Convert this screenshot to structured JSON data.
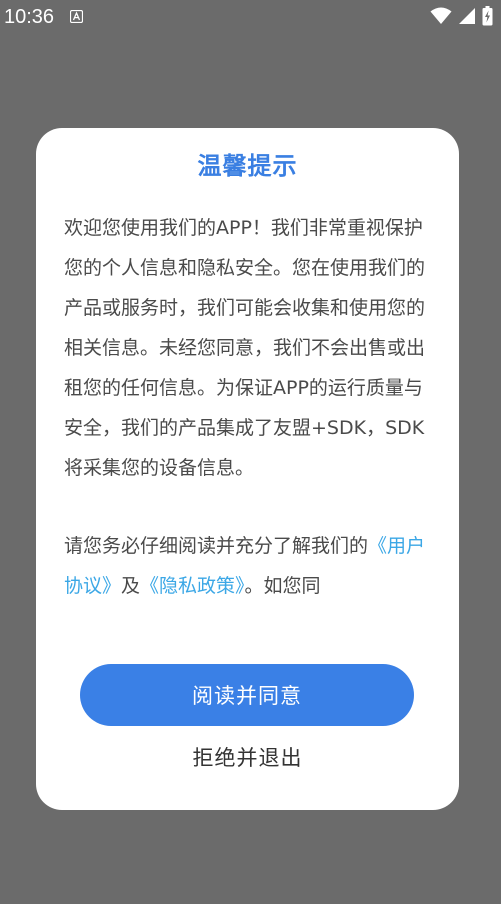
{
  "status_bar": {
    "time": "10:36",
    "notification_icon": "text-a-icon",
    "wifi_icon": "wifi-icon",
    "signal_icon": "cell-signal-icon",
    "battery_icon": "battery-charging-icon"
  },
  "dialog": {
    "title": "温馨提示",
    "paragraph1": "欢迎您使用我们的APP！我们非常重视保护您的个人信息和隐私安全。您在使用我们的产品或服务时，我们可能会收集和使用您的相关信息。未经您同意，我们不会出售或出租您的任何信息。为保证APP的运行质量与安全，我们的产品集成了友盟+SDK，SDK将采集您的设备信息。",
    "paragraph2_lead": "请您务必仔细阅读并充分了解我们的",
    "user_agreement_link": "《用户协议》",
    "connector": "及",
    "privacy_policy_link": "《隐私政策》",
    "paragraph2_tail": "。如您同",
    "agree_button": "阅读并同意",
    "reject_button": "拒绝并退出"
  },
  "colors": {
    "accent": "#3a80e6",
    "title": "#3a7fe2",
    "link": "#3ba7e6",
    "scrim": "#6b6b6b",
    "body_text": "#4a4a4a"
  }
}
